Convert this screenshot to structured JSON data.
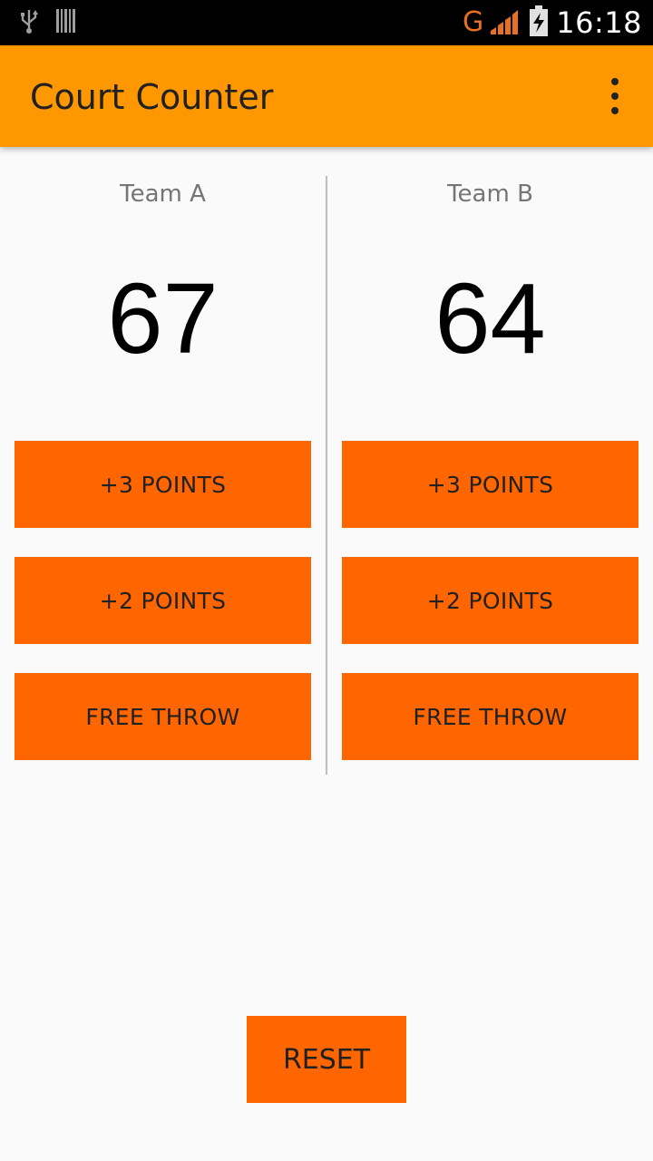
{
  "status_bar": {
    "icons": [
      "usb-icon",
      "barcode-icon",
      "signal-icon",
      "battery-charging-icon"
    ],
    "network_type": "G",
    "time": "16:18",
    "accent_color": "#e8711f"
  },
  "app_bar": {
    "title": "Court Counter",
    "menu_icon": "overflow-menu-icon",
    "color": "#ff9800"
  },
  "team_a": {
    "name": "Team A",
    "score": "67",
    "buttons": {
      "three": "+3 POINTS",
      "two": "+2 POINTS",
      "free_throw": "FREE THROW"
    }
  },
  "team_b": {
    "name": "Team B",
    "score": "64",
    "buttons": {
      "three": "+3 POINTS",
      "two": "+2 POINTS",
      "free_throw": "FREE THROW"
    }
  },
  "reset": {
    "label": "RESET"
  },
  "colors": {
    "button": "#ff6600",
    "background": "#fafafa",
    "divider": "#bdbdbd"
  }
}
